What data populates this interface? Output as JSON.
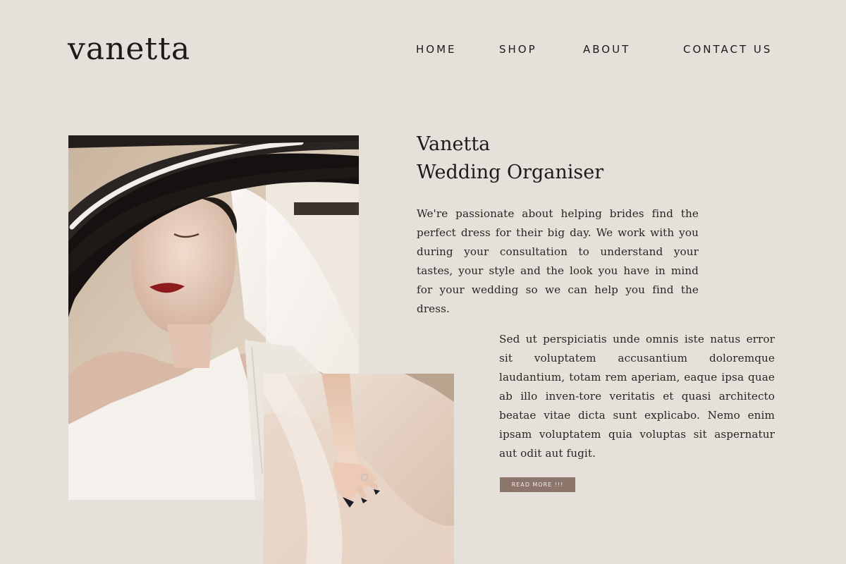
{
  "brand": {
    "logo": "vanetta"
  },
  "nav": {
    "items": [
      {
        "label": "HOME"
      },
      {
        "label": "SHOP"
      },
      {
        "label": "ABOUT"
      },
      {
        "label": "CONTACT US"
      }
    ]
  },
  "hero": {
    "title_line1": "Vanetta",
    "title_line2": "Wedding Organiser",
    "intro": "We're passionate about helping brides find the perfect dress for their big day. We work with you during your consultation to understand your tastes, your style and the look you have in mind for your wedding so we can help you find the dress.",
    "body": "Sed ut perspiciatis unde omnis iste natus error sit voluptatem accusantium doloremque laudantium, totam rem aperiam, eaque ipsa quae ab illo inven-tore veritatis et quasi architecto beatae vitae dicta sunt explicabo. Nemo enim ipsam voluptatem quia voluptas sit aspernatur aut odit aut fugit.",
    "cta_label": "READ MORE !!!"
  },
  "colors": {
    "background": "#e6e0db",
    "text": "#1e1a18",
    "button": "#8c766b"
  }
}
